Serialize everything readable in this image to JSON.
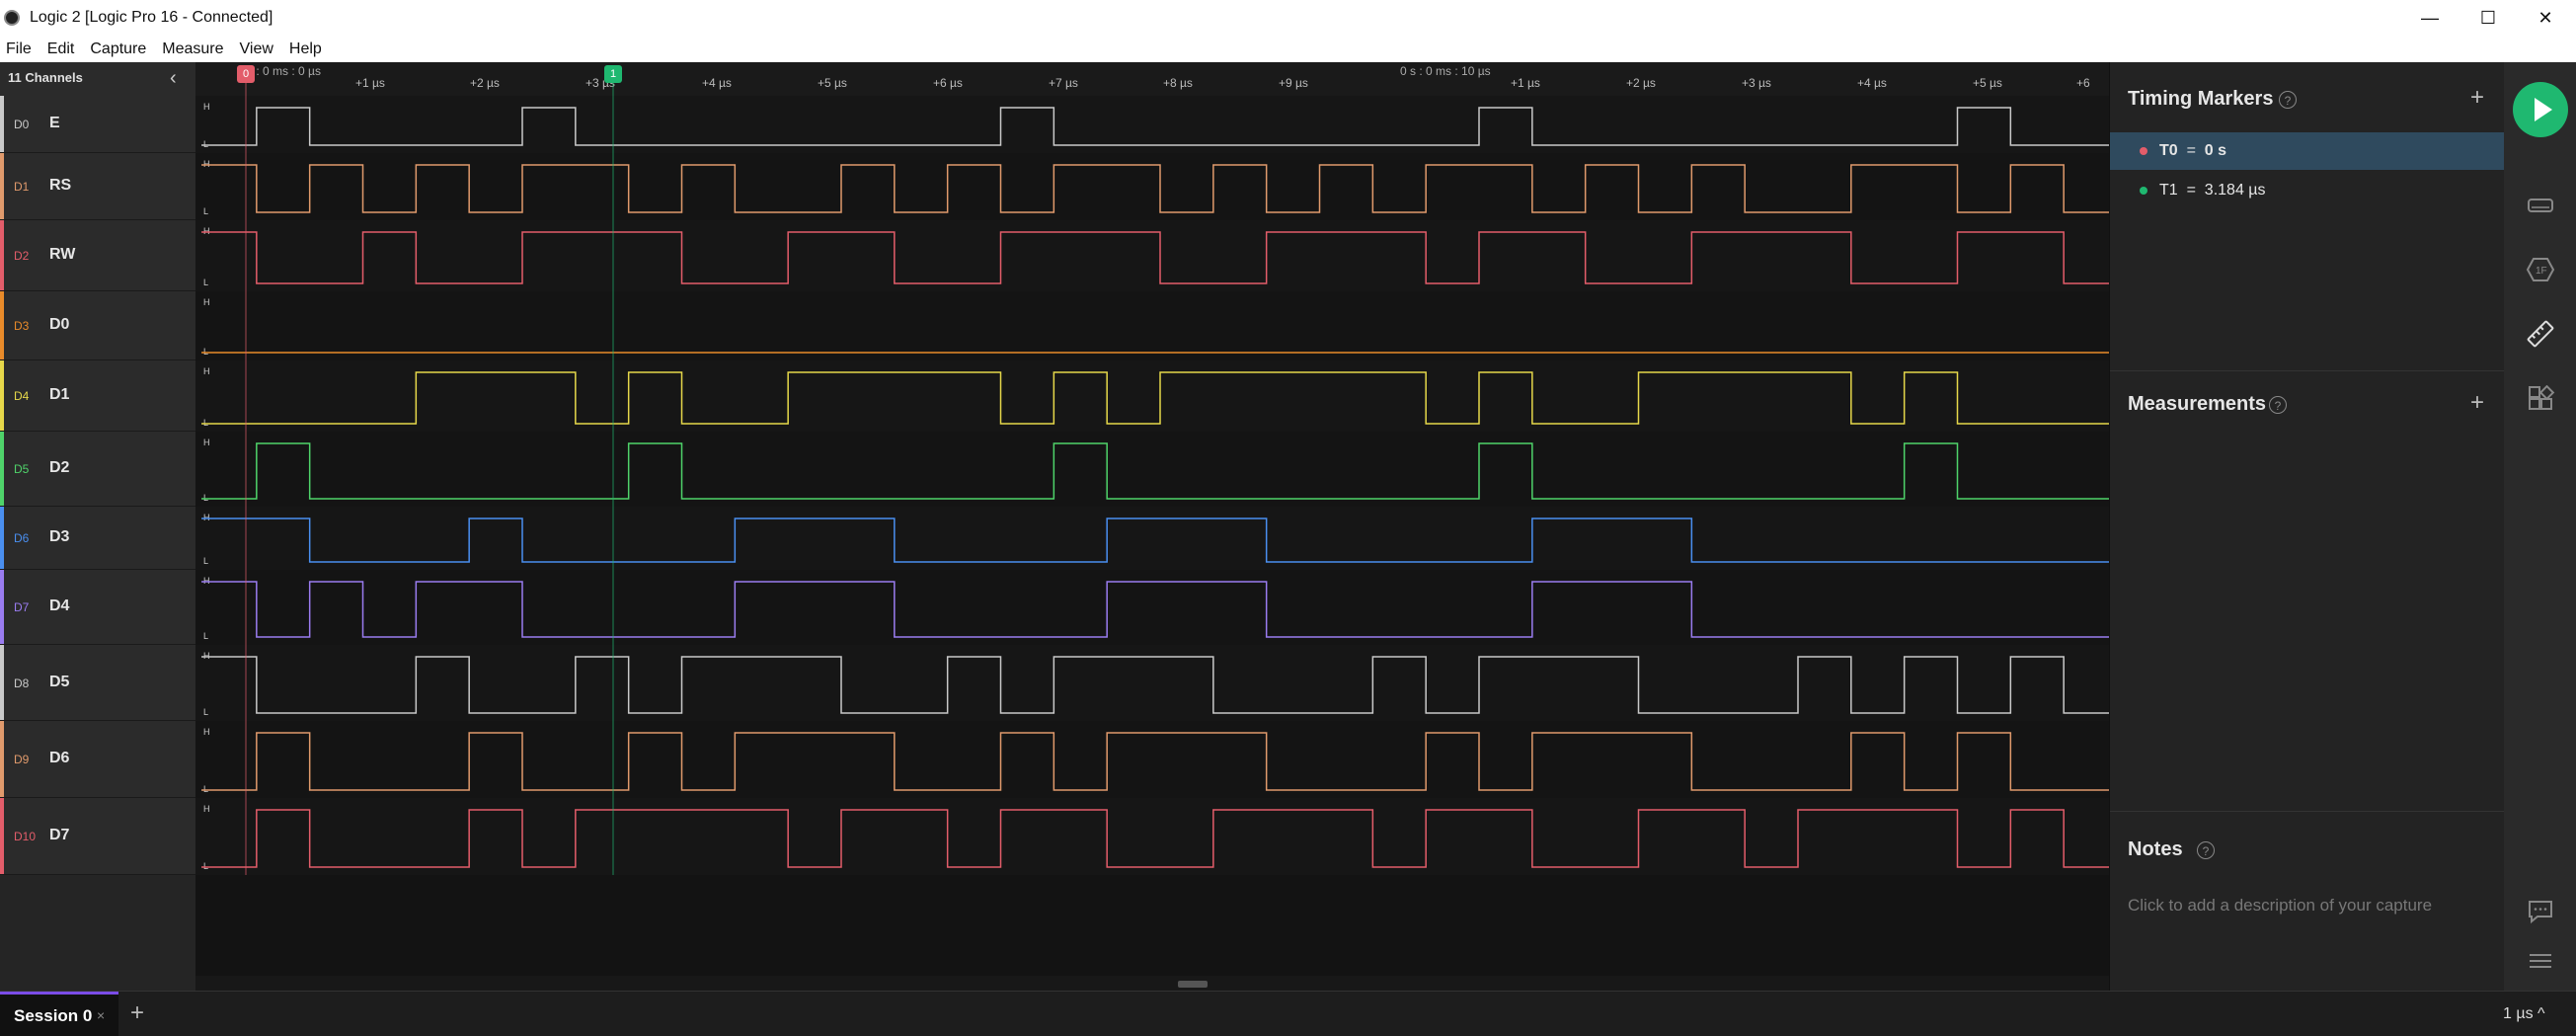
{
  "window": {
    "title": "Logic 2 [Logic Pro 16 - Connected]",
    "minimize": "—",
    "maximize": "☐",
    "close": "✕"
  },
  "menu": [
    "File",
    "Edit",
    "Capture",
    "Measure",
    "View",
    "Help"
  ],
  "sidebar": {
    "header": "11 Channels",
    "channels": [
      {
        "index": "D0",
        "name": "E",
        "color": "#c9c9c9"
      },
      {
        "index": "D1",
        "name": "RS",
        "color": "#e09a6c"
      },
      {
        "index": "D2",
        "name": "RW",
        "color": "#e35d6a"
      },
      {
        "index": "D3",
        "name": "D0",
        "color": "#e98b2a"
      },
      {
        "index": "D4",
        "name": "D1",
        "color": "#e6d84a"
      },
      {
        "index": "D5",
        "name": "D2",
        "color": "#4fd36a"
      },
      {
        "index": "D6",
        "name": "D3",
        "color": "#4a8ff0"
      },
      {
        "index": "D7",
        "name": "D4",
        "color": "#9a7cf0"
      },
      {
        "index": "D8",
        "name": "D5",
        "color": "#c9c9c9"
      },
      {
        "index": "D9",
        "name": "D6",
        "color": "#e09a6c"
      },
      {
        "index": "D10",
        "name": "D7",
        "color": "#e35d6a"
      }
    ]
  },
  "ruler": {
    "origin_label": "0 s : 0 ms : 0 µs",
    "center_label": "0 s : 0 ms : 10 µs",
    "ticks": [
      "+1 µs",
      "+2 µs",
      "+3 µs",
      "+4 µs",
      "+5 µs",
      "+6 µs",
      "+7 µs",
      "+8 µs",
      "+9 µs",
      "+1 µs",
      "+2 µs",
      "+3 µs",
      "+4 µs",
      "+5 µs",
      "+6"
    ],
    "marker0_label": "0",
    "marker1_label": "1"
  },
  "timing_markers": {
    "title": "Timing Markers",
    "items": [
      {
        "label": "T0",
        "eq": "=",
        "value": "0 s",
        "color": "#e35d6a",
        "selected": true
      },
      {
        "label": "T1",
        "eq": "=",
        "value": "3.184 µs",
        "color": "#1fb870",
        "selected": false
      }
    ]
  },
  "measurements": {
    "title": "Measurements"
  },
  "notes": {
    "title": "Notes",
    "placeholder": "Click to add a description of your capture"
  },
  "bottom": {
    "tab_label": "Session 0",
    "tab_close": "×",
    "new_tab": "+",
    "zoom": "1 µs ^"
  },
  "icons": {
    "help": "?",
    "plus": "+",
    "collapse": "‹"
  }
}
